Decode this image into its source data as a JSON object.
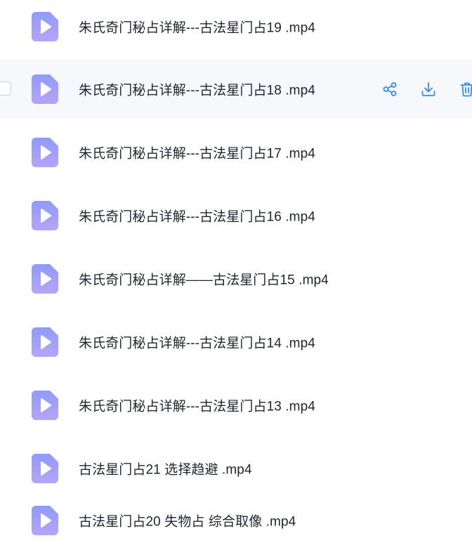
{
  "file_list": {
    "items": [
      {
        "name": "朱氏奇门秘占详解---古法星门占19 .mp4",
        "icon": "video-file-icon",
        "hovered": false
      },
      {
        "name": "朱氏奇门秘占详解---古法星门占18 .mp4",
        "icon": "video-file-icon",
        "hovered": true
      },
      {
        "name": "朱氏奇门秘占详解---古法星门占17 .mp4",
        "icon": "video-file-icon",
        "hovered": false
      },
      {
        "name": "朱氏奇门秘占详解---古法星门占16 .mp4",
        "icon": "video-file-icon",
        "hovered": false
      },
      {
        "name": "朱氏奇门秘占详解——古法星门占15 .mp4",
        "icon": "video-file-icon",
        "hovered": false
      },
      {
        "name": "朱氏奇门秘占详解---古法星门占14 .mp4",
        "icon": "video-file-icon",
        "hovered": false
      },
      {
        "name": "朱氏奇门秘占详解---古法星门占13 .mp4",
        "icon": "video-file-icon",
        "hovered": false
      },
      {
        "name": "古法星门占21 选择趋避 .mp4",
        "icon": "video-file-icon",
        "hovered": false
      },
      {
        "name": "古法星门占20 失物占 综合取像 .mp4",
        "icon": "video-file-icon",
        "hovered": false
      }
    ],
    "row_actions": [
      "share-icon",
      "download-icon",
      "trash-icon"
    ]
  },
  "colors": {
    "icon_gradient_top": "#8f9bff",
    "icon_gradient_bottom": "#b6a4f8",
    "action_blue": "#2f8cf0",
    "hover_row_bg": "#f6f8fc",
    "text": "#1f2430"
  }
}
